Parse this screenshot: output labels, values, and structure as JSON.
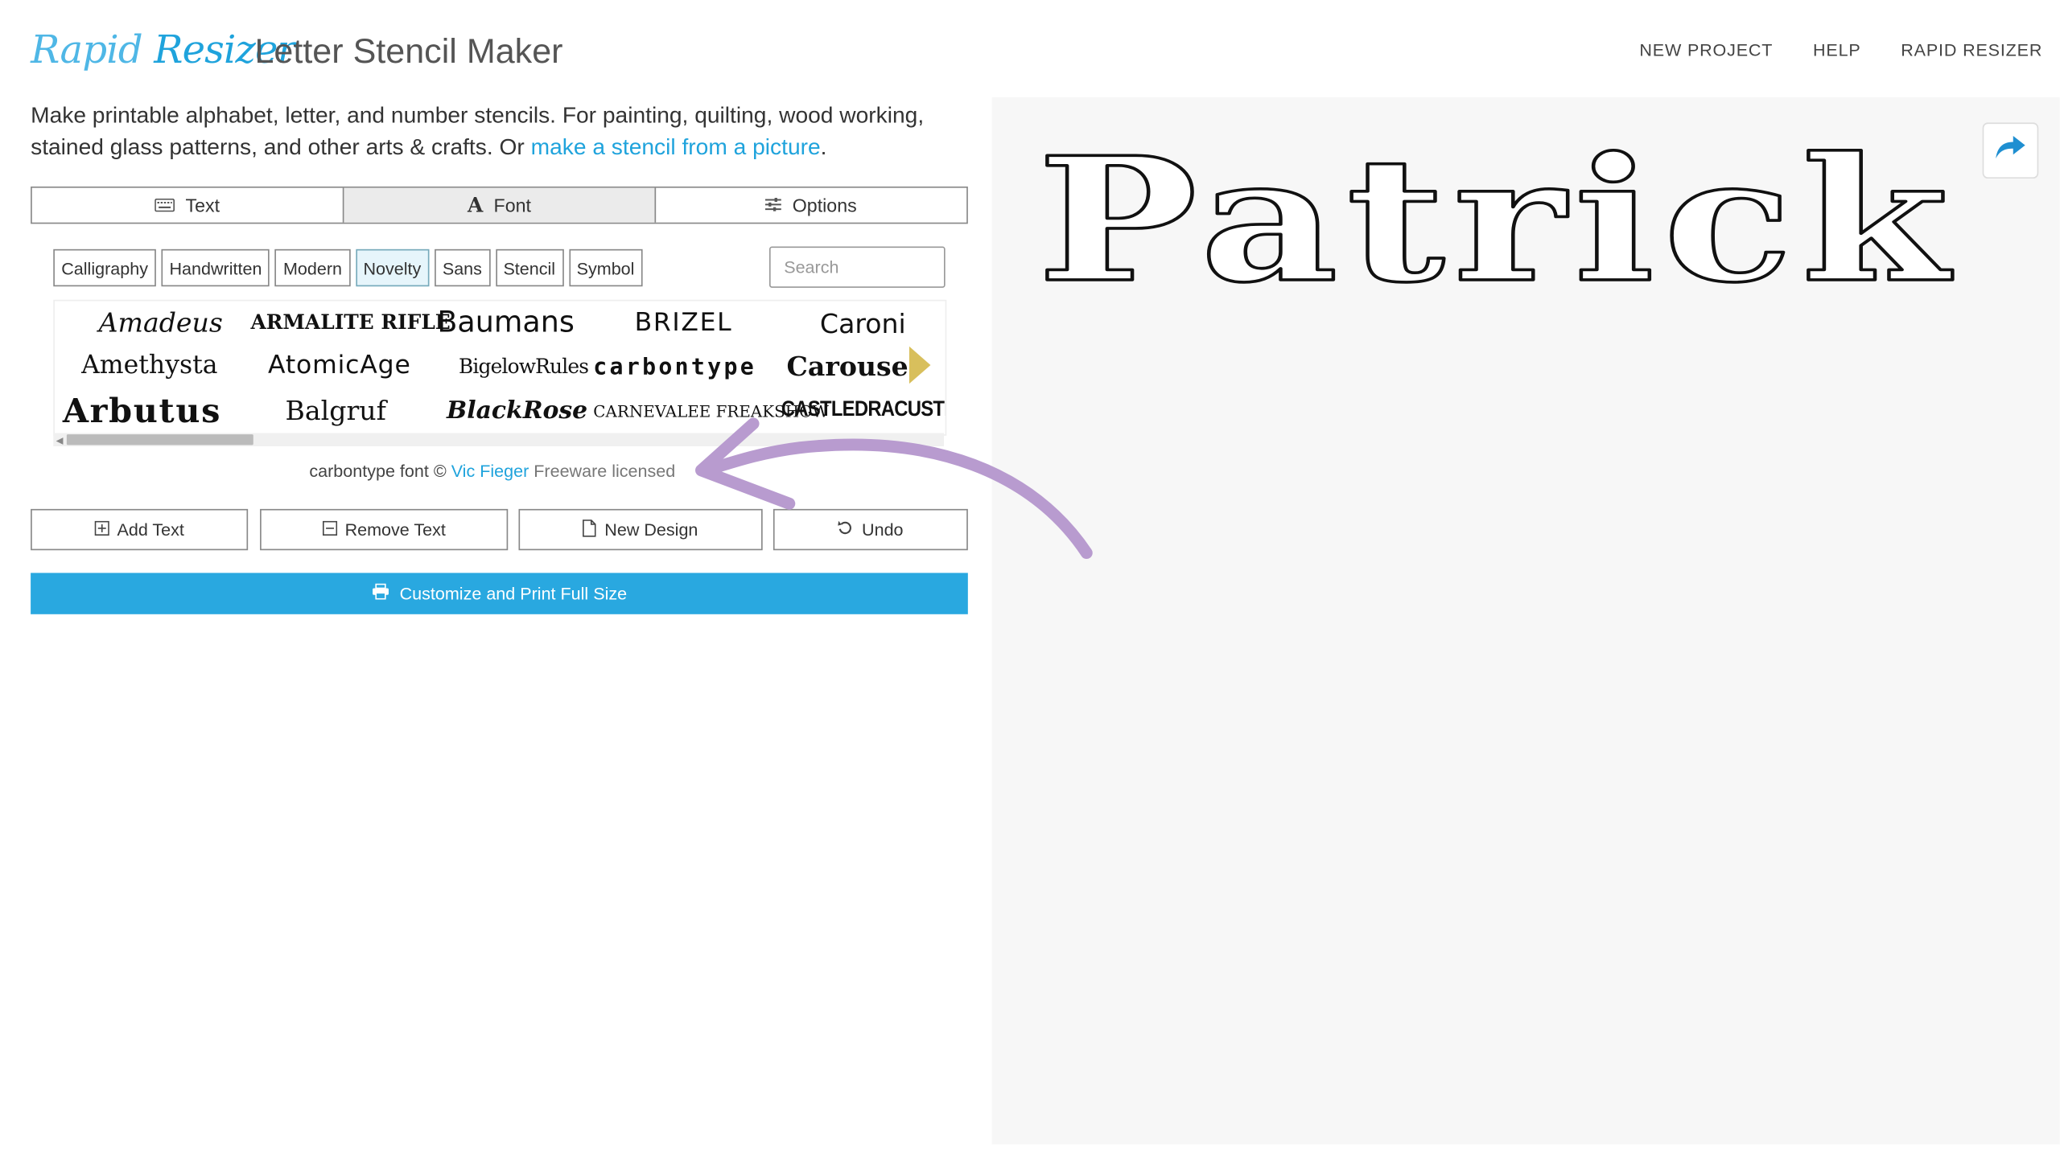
{
  "header": {
    "logo_text_1": "Rapid",
    "logo_text_2": "Resizer",
    "title": "Letter Stencil Maker",
    "nav": [
      "NEW PROJECT",
      "HELP",
      "RAPID RESIZER"
    ]
  },
  "intro": {
    "text": "Make printable alphabet, letter, and number stencils. For painting, quilting, wood working, stained glass patterns, and other arts & crafts. Or ",
    "link": "make a stencil from a picture",
    "end": "."
  },
  "tabs": [
    {
      "label": "Text",
      "icon": "keyboard-icon"
    },
    {
      "label": "Font",
      "icon": "font-icon",
      "active": true
    },
    {
      "label": "Options",
      "icon": "sliders-icon"
    }
  ],
  "categories": [
    {
      "label": "Calligraphy"
    },
    {
      "label": "Handwritten"
    },
    {
      "label": "Modern"
    },
    {
      "label": "Novelty",
      "active": true
    },
    {
      "label": "Sans"
    },
    {
      "label": "Stencil"
    },
    {
      "label": "Symbol"
    }
  ],
  "search": {
    "placeholder": "Search"
  },
  "fonts": [
    "Amadeus",
    "ARMALITE RIFLE",
    "Baumans",
    "BRIZEL",
    "Caroni",
    "Amethysta",
    "AtomicAge",
    "BigelowRules",
    "carbontype",
    "Carouse",
    "Arbutus",
    "Balgruf",
    "BlackRose",
    "CARNEVALEE FREAKSHOW",
    "CASTLEDRACUSTEIN"
  ],
  "credit": {
    "prefix": "carbontype font © ",
    "author": "Vic Fieger",
    "license": " Freeware licensed"
  },
  "actions": {
    "add": "Add Text",
    "remove": "Remove Text",
    "new": "New Design",
    "undo": "Undo",
    "print": "Customize and Print Full Size"
  },
  "stencil_text": "Patrick",
  "colors": {
    "accent": "#29a8e0",
    "annotation_arrow": "#b89bcf"
  }
}
